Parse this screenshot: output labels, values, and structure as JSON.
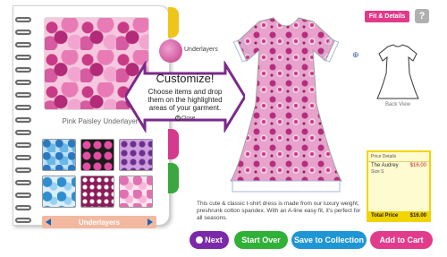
{
  "book": {
    "fabric_name": "Pink  Paisley  Underlayer",
    "category_label": "Underlayers"
  },
  "underlayers_icon_label": "Underlayers",
  "callout": {
    "title": "Customize!",
    "text": "Choose items and drop them on the highlighted areas of your garment.",
    "close_label": "Close"
  },
  "top": {
    "fit_details_label": "Fit & Details",
    "help_label": "?"
  },
  "back_view_label": "Back View",
  "price": {
    "header": "Price Details",
    "item_name": "The Audrey",
    "item_price": "$16.00",
    "size": "Size S",
    "total_label": "Total Price",
    "total_value": "$16.00"
  },
  "description": "This cute & classic t-shirt dress is made from our luxury weight, preshrunk cotton spandex. With an A-line easy fit, it's perfect for all seasons.",
  "buttons": {
    "next": "Next",
    "start_over": "Start Over",
    "save": "Save to Collection",
    "cart": "Add to Cart"
  },
  "colors": {
    "pink": "#e23b8c",
    "purple": "#7a2aa8",
    "green": "#2fb036",
    "blue": "#1e96d6",
    "yellow": "#f2d400"
  }
}
